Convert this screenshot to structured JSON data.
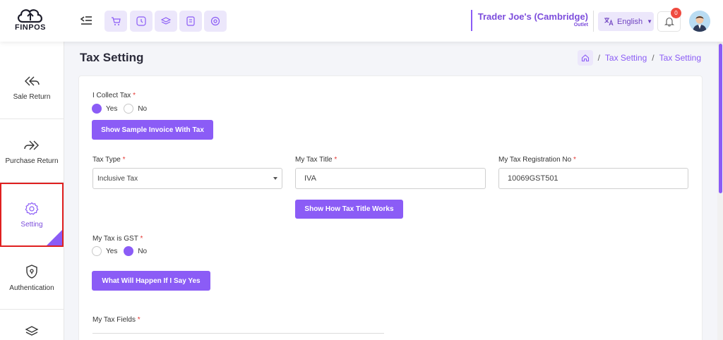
{
  "header": {
    "logo_text": "FINPOS",
    "quick_icons": [
      "cart-icon",
      "clock-icon",
      "layers-icon",
      "receipt-icon",
      "settings-dial-icon"
    ],
    "store_name": "Trader Joe's (Cambridge)",
    "store_sub": "Outlet",
    "language": "English",
    "notification_count": "0"
  },
  "sidebar": {
    "items": [
      {
        "label": "Sale Return",
        "icon": "sale-return-icon"
      },
      {
        "label": "Purchase Return",
        "icon": "purchase-return-icon"
      },
      {
        "label": "Setting",
        "icon": "gear-icon"
      },
      {
        "label": "Authentication",
        "icon": "shield-icon"
      }
    ]
  },
  "page": {
    "title": "Tax Setting",
    "breadcrumb": [
      "Tax Setting",
      "Tax Setting"
    ]
  },
  "form": {
    "collect_tax_label": "I Collect Tax",
    "yes": "Yes",
    "no": "No",
    "collect_tax_value": "Yes",
    "sample_invoice_button": "Show Sample Invoice With Tax",
    "tax_type_label": "Tax Type",
    "tax_type_value": "Inclusive Tax",
    "tax_title_label": "My Tax Title",
    "tax_title_value": "IVA",
    "tax_reg_label": "My Tax Registration No",
    "tax_reg_value": "10069GST501",
    "tax_title_button": "Show How Tax Title Works",
    "gst_label": "My Tax is GST",
    "gst_value": "No",
    "gst_button": "What Will Happen If I Say Yes",
    "tax_fields_label": "My Tax Fields",
    "required_mark": "*"
  },
  "colors": {
    "accent": "#8b5cf6",
    "accent_light": "#ece7fb",
    "danger": "#e53935",
    "highlight_border": "#e02020"
  }
}
